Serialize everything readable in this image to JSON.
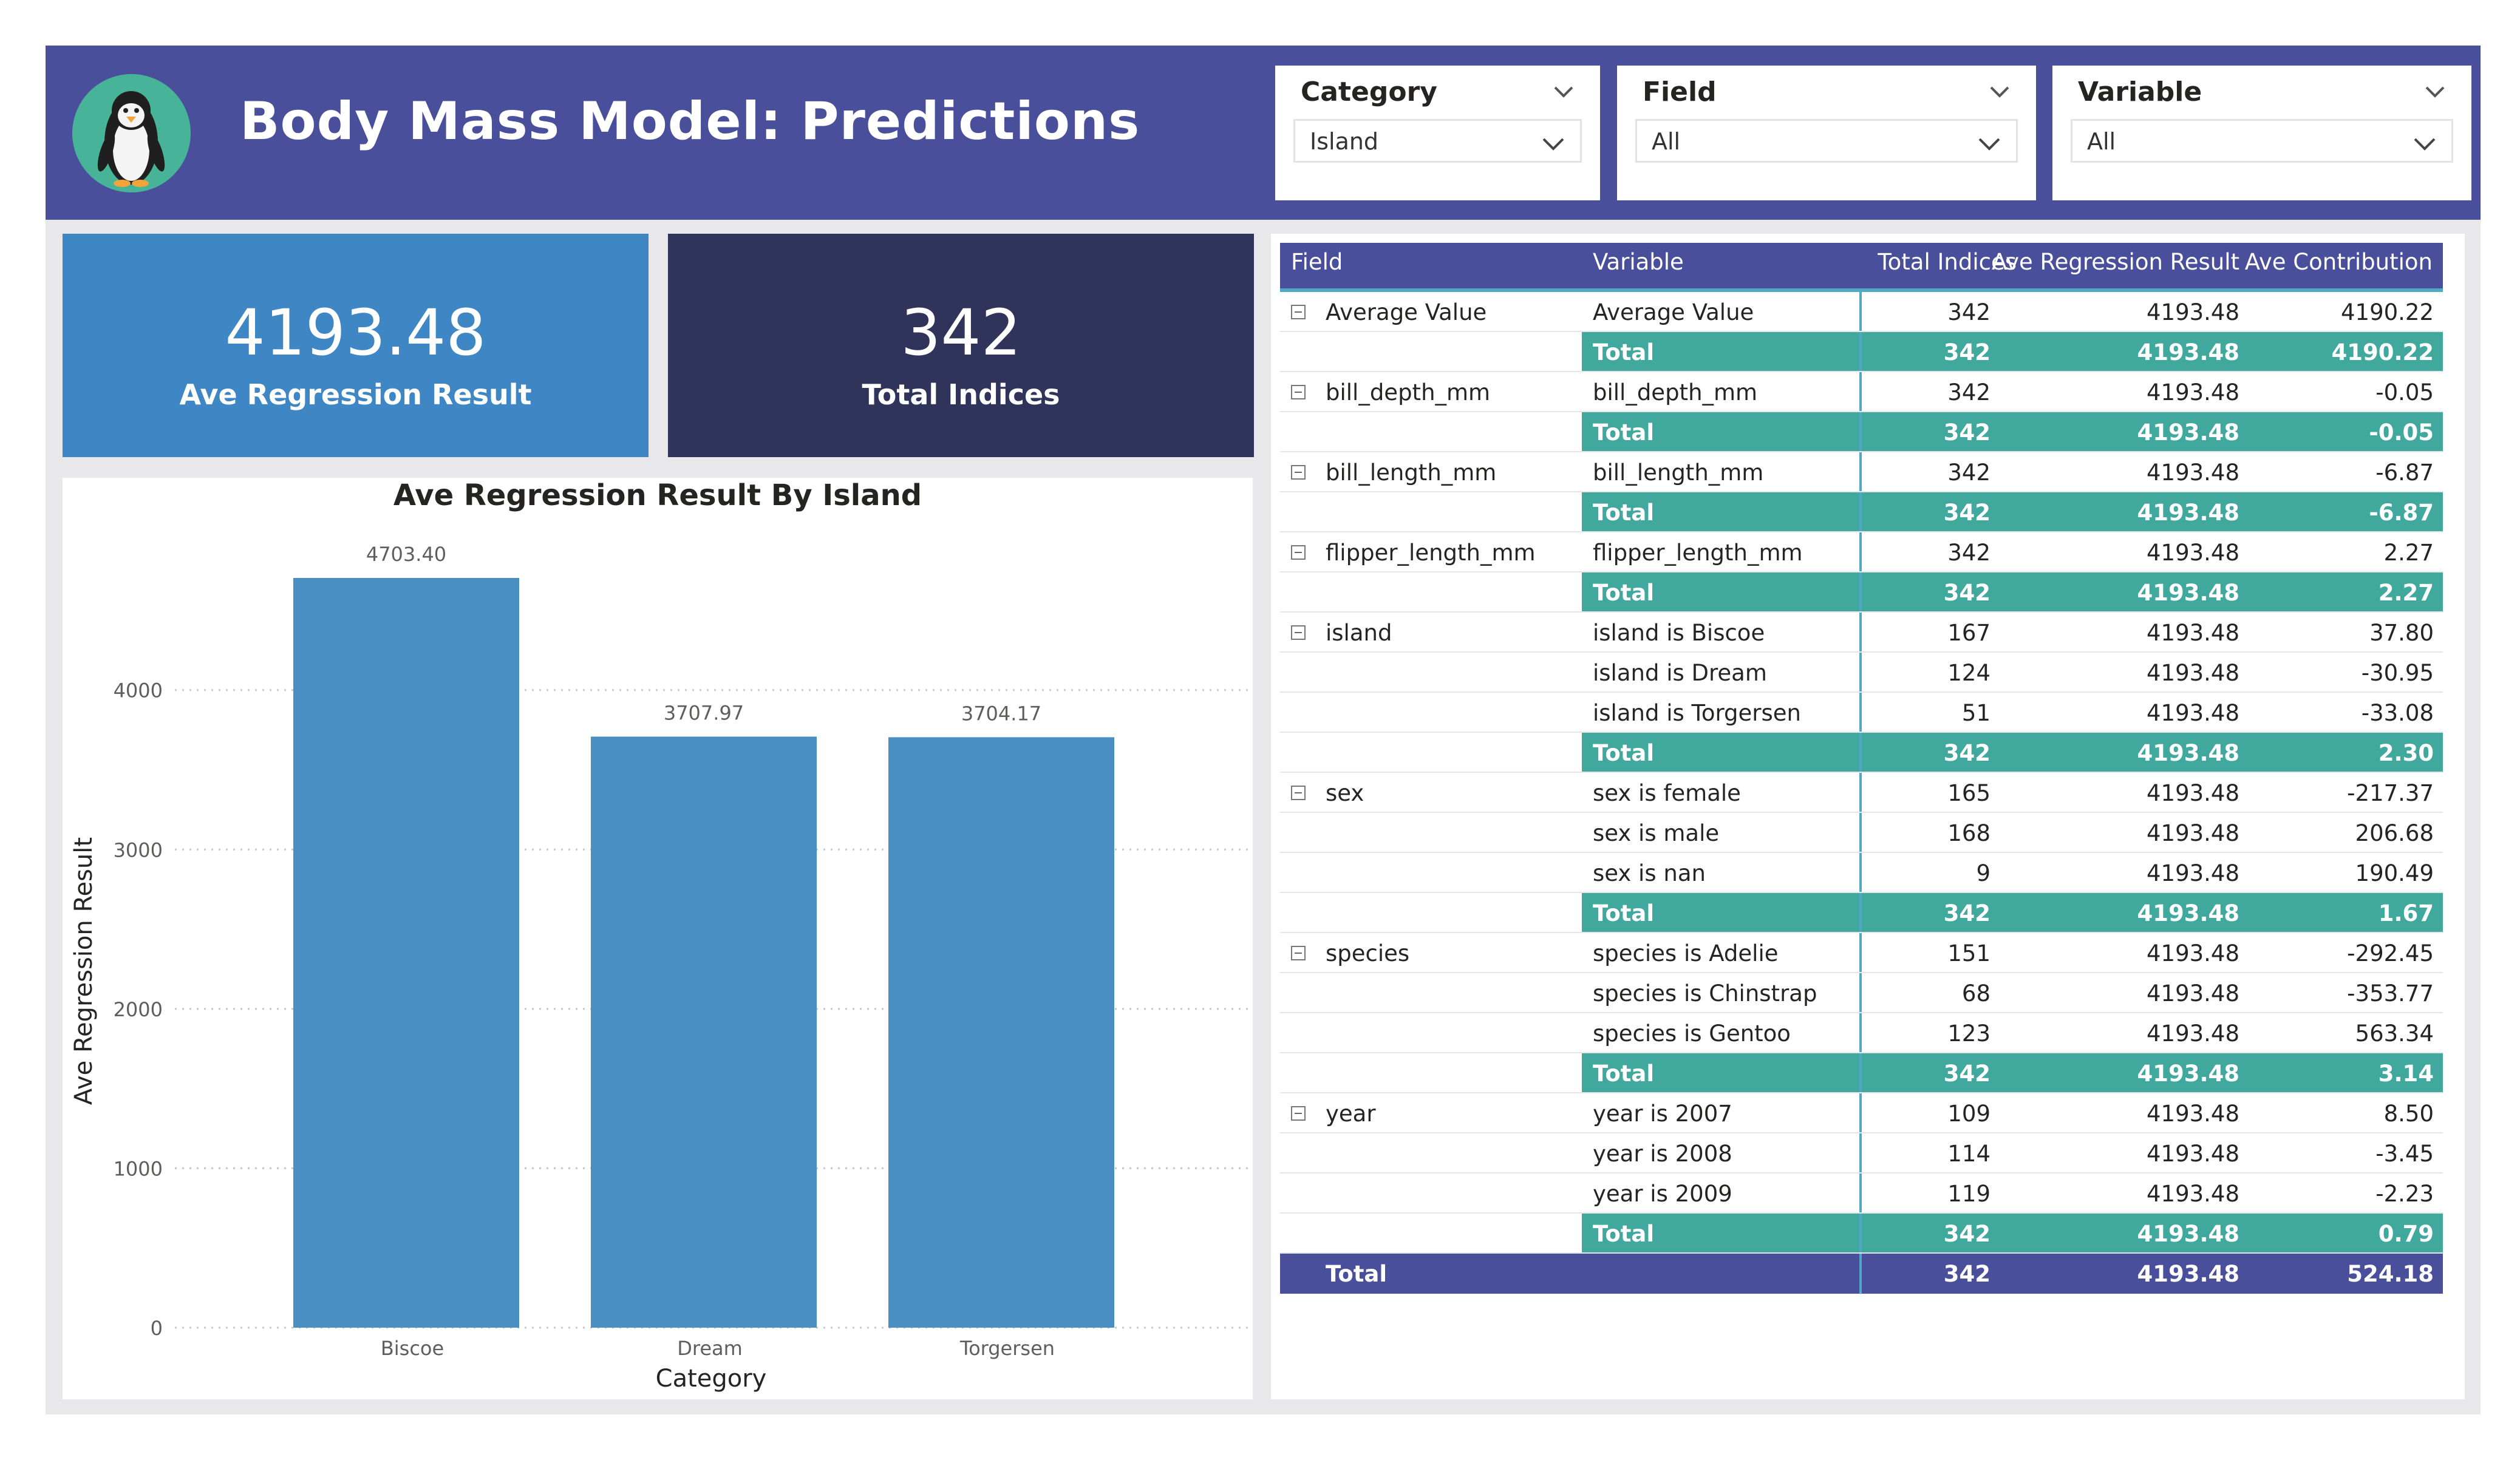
{
  "header": {
    "title": "Body Mass Model: Predictions",
    "logo_icon": "penguin-icon",
    "background": "#4a4f9c"
  },
  "slicers": [
    {
      "label": "Category",
      "value": "Island"
    },
    {
      "label": "Field",
      "value": "All"
    },
    {
      "label": "Variable",
      "value": "All"
    }
  ],
  "kpis": {
    "ave_regression": {
      "value": "4193.48",
      "label": "Ave Regression Result",
      "color": "#3f87c4"
    },
    "total_indices": {
      "value": "342",
      "label": "Total Indices",
      "color": "#30345a"
    }
  },
  "chart_data": {
    "type": "bar",
    "title": "Ave Regression Result By Island",
    "xlabel": "Category",
    "ylabel": "Ave Regression Result",
    "categories": [
      "Biscoe",
      "Dream",
      "Torgersen"
    ],
    "values": [
      4703.4,
      3707.97,
      3704.17
    ],
    "data_labels": [
      "4703.40",
      "3707.97",
      "3704.17"
    ],
    "yticks": [
      0,
      1000,
      2000,
      3000,
      4000
    ],
    "ylim": [
      0,
      4703.4
    ],
    "bar_color": "#4a8fc2",
    "grid": true
  },
  "table": {
    "columns": [
      "Field",
      "Variable",
      "Total Indices",
      "Ave Regression Result",
      "Ave Contribution"
    ],
    "groups": [
      {
        "field": "Average Value",
        "rows": [
          [
            "Average Value",
            "342",
            "4193.48",
            "4190.22"
          ]
        ],
        "total": [
          "Total",
          "342",
          "4193.48",
          "4190.22"
        ]
      },
      {
        "field": "bill_depth_mm",
        "rows": [
          [
            "bill_depth_mm",
            "342",
            "4193.48",
            "-0.05"
          ]
        ],
        "total": [
          "Total",
          "342",
          "4193.48",
          "-0.05"
        ]
      },
      {
        "field": "bill_length_mm",
        "rows": [
          [
            "bill_length_mm",
            "342",
            "4193.48",
            "-6.87"
          ]
        ],
        "total": [
          "Total",
          "342",
          "4193.48",
          "-6.87"
        ]
      },
      {
        "field": "flipper_length_mm",
        "rows": [
          [
            "flipper_length_mm",
            "342",
            "4193.48",
            "2.27"
          ]
        ],
        "total": [
          "Total",
          "342",
          "4193.48",
          "2.27"
        ]
      },
      {
        "field": "island",
        "rows": [
          [
            "island is Biscoe",
            "167",
            "4193.48",
            "37.80"
          ],
          [
            "island is Dream",
            "124",
            "4193.48",
            "-30.95"
          ],
          [
            "island is Torgersen",
            "51",
            "4193.48",
            "-33.08"
          ]
        ],
        "total": [
          "Total",
          "342",
          "4193.48",
          "2.30"
        ]
      },
      {
        "field": "sex",
        "rows": [
          [
            "sex is female",
            "165",
            "4193.48",
            "-217.37"
          ],
          [
            "sex is male",
            "168",
            "4193.48",
            "206.68"
          ],
          [
            "sex is nan",
            "9",
            "4193.48",
            "190.49"
          ]
        ],
        "total": [
          "Total",
          "342",
          "4193.48",
          "1.67"
        ]
      },
      {
        "field": "species",
        "rows": [
          [
            "species is Adelie",
            "151",
            "4193.48",
            "-292.45"
          ],
          [
            "species is Chinstrap",
            "68",
            "4193.48",
            "-353.77"
          ],
          [
            "species is Gentoo",
            "123",
            "4193.48",
            "563.34"
          ]
        ],
        "total": [
          "Total",
          "342",
          "4193.48",
          "3.14"
        ]
      },
      {
        "field": "year",
        "rows": [
          [
            "year is 2007",
            "109",
            "4193.48",
            "8.50"
          ],
          [
            "year is 2008",
            "114",
            "4193.48",
            "-3.45"
          ],
          [
            "year is 2009",
            "119",
            "4193.48",
            "-2.23"
          ]
        ],
        "total": [
          "Total",
          "342",
          "4193.48",
          "0.79"
        ]
      }
    ],
    "grand_total": [
      "Total",
      "342",
      "4193.48",
      "524.18"
    ],
    "subtotal_color": "#41a89d",
    "header_color": "#4a4f9c"
  }
}
